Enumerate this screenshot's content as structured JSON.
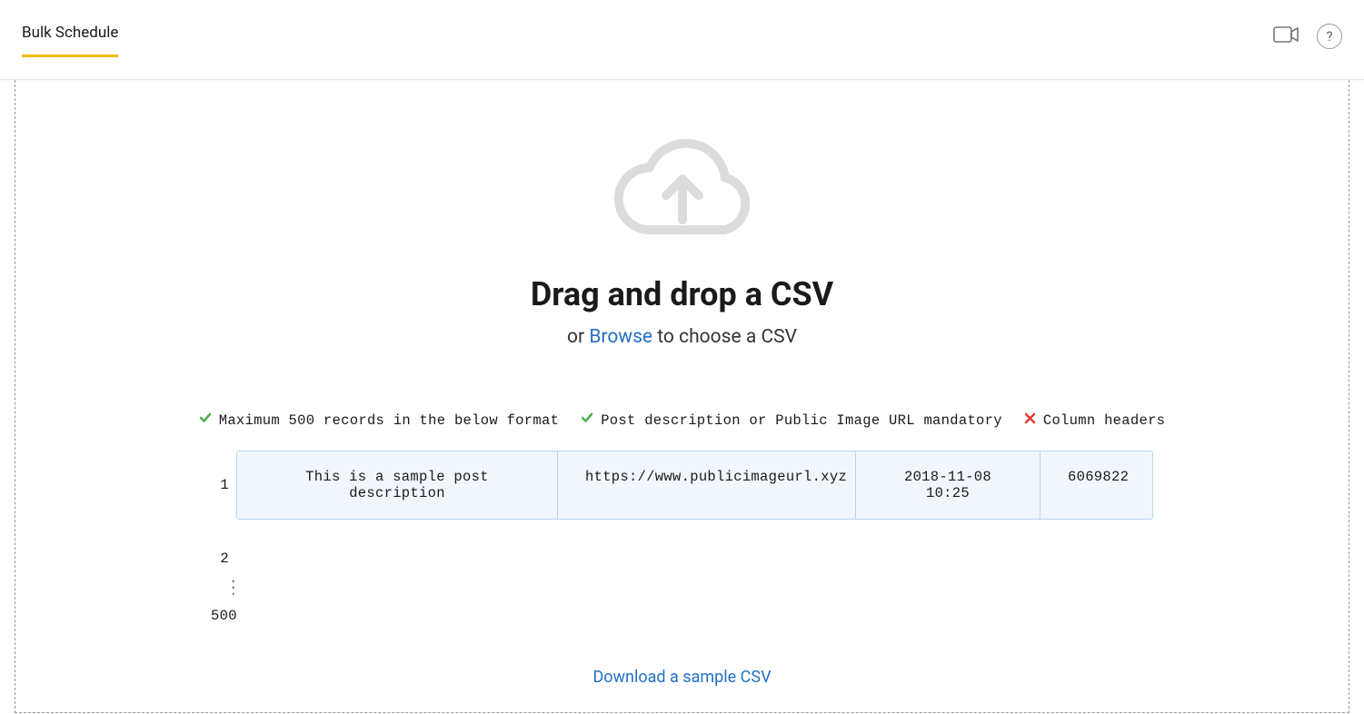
{
  "header": {
    "tab_label": "Bulk Schedule"
  },
  "dropzone": {
    "title": "Drag and drop a CSV",
    "subtitle_prefix": "or ",
    "browse_label": "Browse",
    "subtitle_suffix": " to choose a CSV"
  },
  "rules": [
    "Maximum 500 records in the below format",
    "Post description or Public Image URL mandatory",
    "Column headers"
  ],
  "sample": {
    "row_1_num": "1",
    "cells": {
      "description": "This is a sample post description",
      "image_url": "https://www.publicimageurl.xyz",
      "datetime": "2018-11-08 10:25",
      "id": "6069822"
    },
    "row_2_num": "2",
    "row_last_num": "500"
  },
  "download_label": "Download a sample CSV"
}
